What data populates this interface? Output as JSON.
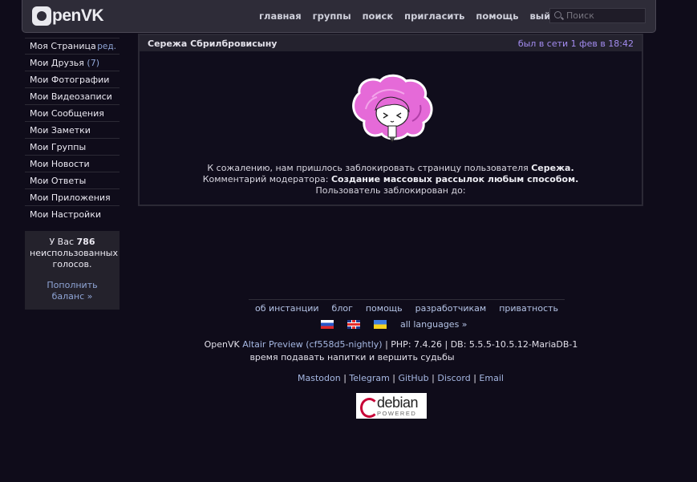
{
  "header": {
    "logo_text": "penVK",
    "nav": [
      "главная",
      "группы",
      "поиск",
      "пригласить",
      "помощь",
      "выйти"
    ],
    "search_placeholder": "Поиск"
  },
  "sidebar": {
    "items": [
      {
        "label": "Моя Страница",
        "extra": "ред."
      },
      {
        "label": "Мои Друзья",
        "count": "(7)"
      },
      {
        "label": "Мои Фотографии"
      },
      {
        "label": "Мои Видеозаписи"
      },
      {
        "label": "Мои Сообщения"
      },
      {
        "label": "Мои Заметки"
      },
      {
        "label": "Мои Группы"
      },
      {
        "label": "Мои Новости"
      },
      {
        "label": "Мои Ответы"
      },
      {
        "label": "Мои Приложения"
      },
      {
        "label": "Мои Настройки"
      }
    ],
    "balance": {
      "prefix": "У Вас",
      "votes": "786",
      "suffix": "неиспользованных голосов.",
      "topup_link": "Пополнить баланс »"
    }
  },
  "profile": {
    "name": "Сережа Сбрилбровисыну",
    "status": "был в сети 1 фев в 18:42",
    "blocked_line1_prefix": "К сожалению, нам пришлось заблокировать страницу пользователя",
    "blocked_user": "Сережа.",
    "comment_prefix": "Комментарий модератора:",
    "comment_text": "Создание массовых рассылок любым способом.",
    "blocked_until": "Пользователь заблокирован до:"
  },
  "footer": {
    "links": [
      "об инстанции",
      "блог",
      "помощь",
      "разработчикам",
      "приватность"
    ],
    "all_languages": "all languages »",
    "version_prefix": "OpenVK",
    "version_link": "Altair Preview (cf558d5-nightly)",
    "version_suffix": "| PHP: 7.4.26 | DB: 5.5.5-10.5.12-MariaDB-1",
    "tagline": "время подавать напитки и вершить судьбы",
    "socials": [
      "Mastodon",
      "Telegram",
      "GitHub",
      "Discord",
      "Email"
    ],
    "debian_word": "debian",
    "debian_sub": "POWERED"
  }
}
